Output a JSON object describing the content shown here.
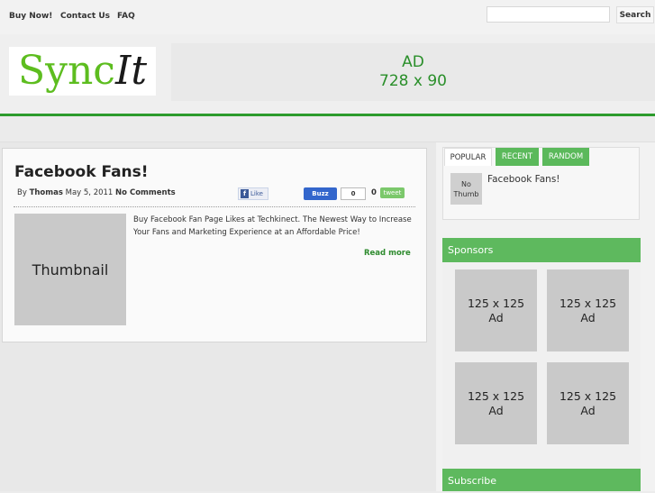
{
  "nav": {
    "items": [
      "Buy Now!",
      "Contact Us",
      "FAQ"
    ]
  },
  "search": {
    "placeholder": "",
    "button_label": "Search"
  },
  "logo": {
    "part1": "Sync",
    "part2": "It"
  },
  "header_ad": {
    "line1": "AD",
    "line2": "728 x 90"
  },
  "post": {
    "title": "Facebook Fans!",
    "by_label": "By",
    "author": "Thomas",
    "date": "May 5, 2011",
    "comments": "No Comments",
    "like_label": "Like",
    "like_icon": "f",
    "buzz_label": "Buzz",
    "buzz_count": "0",
    "tweet_count": "0",
    "tweet_label": "tweet",
    "thumbnail_label": "Thumbnail",
    "excerpt": "Buy Facebook Fan Page Likes at Techkinect. The Newest Way to Increase Your Fans and Marketing Experience at an Affordable Price!",
    "read_more": "Read more"
  },
  "sidebar": {
    "tabs": [
      "POPULAR",
      "RECENT",
      "RANDOM"
    ],
    "popular_item": {
      "thumb_line1": "No",
      "thumb_line2": "Thumb",
      "title": "Facebook Fans!"
    },
    "sponsors_title": "Sponsors",
    "sponsor_ads": [
      {
        "line1": "125 x 125",
        "line2": "Ad"
      },
      {
        "line1": "125 x 125",
        "line2": "Ad"
      },
      {
        "line1": "125 x 125",
        "line2": "Ad"
      },
      {
        "line1": "125 x 125",
        "line2": "Ad"
      }
    ],
    "subscribe_title": "Subscribe"
  },
  "colors": {
    "accent_green": "#5eb95e",
    "logo_green": "#5dbd1f",
    "ad_text_green": "#2a8f2a",
    "header_line": "#2c9b2c"
  }
}
